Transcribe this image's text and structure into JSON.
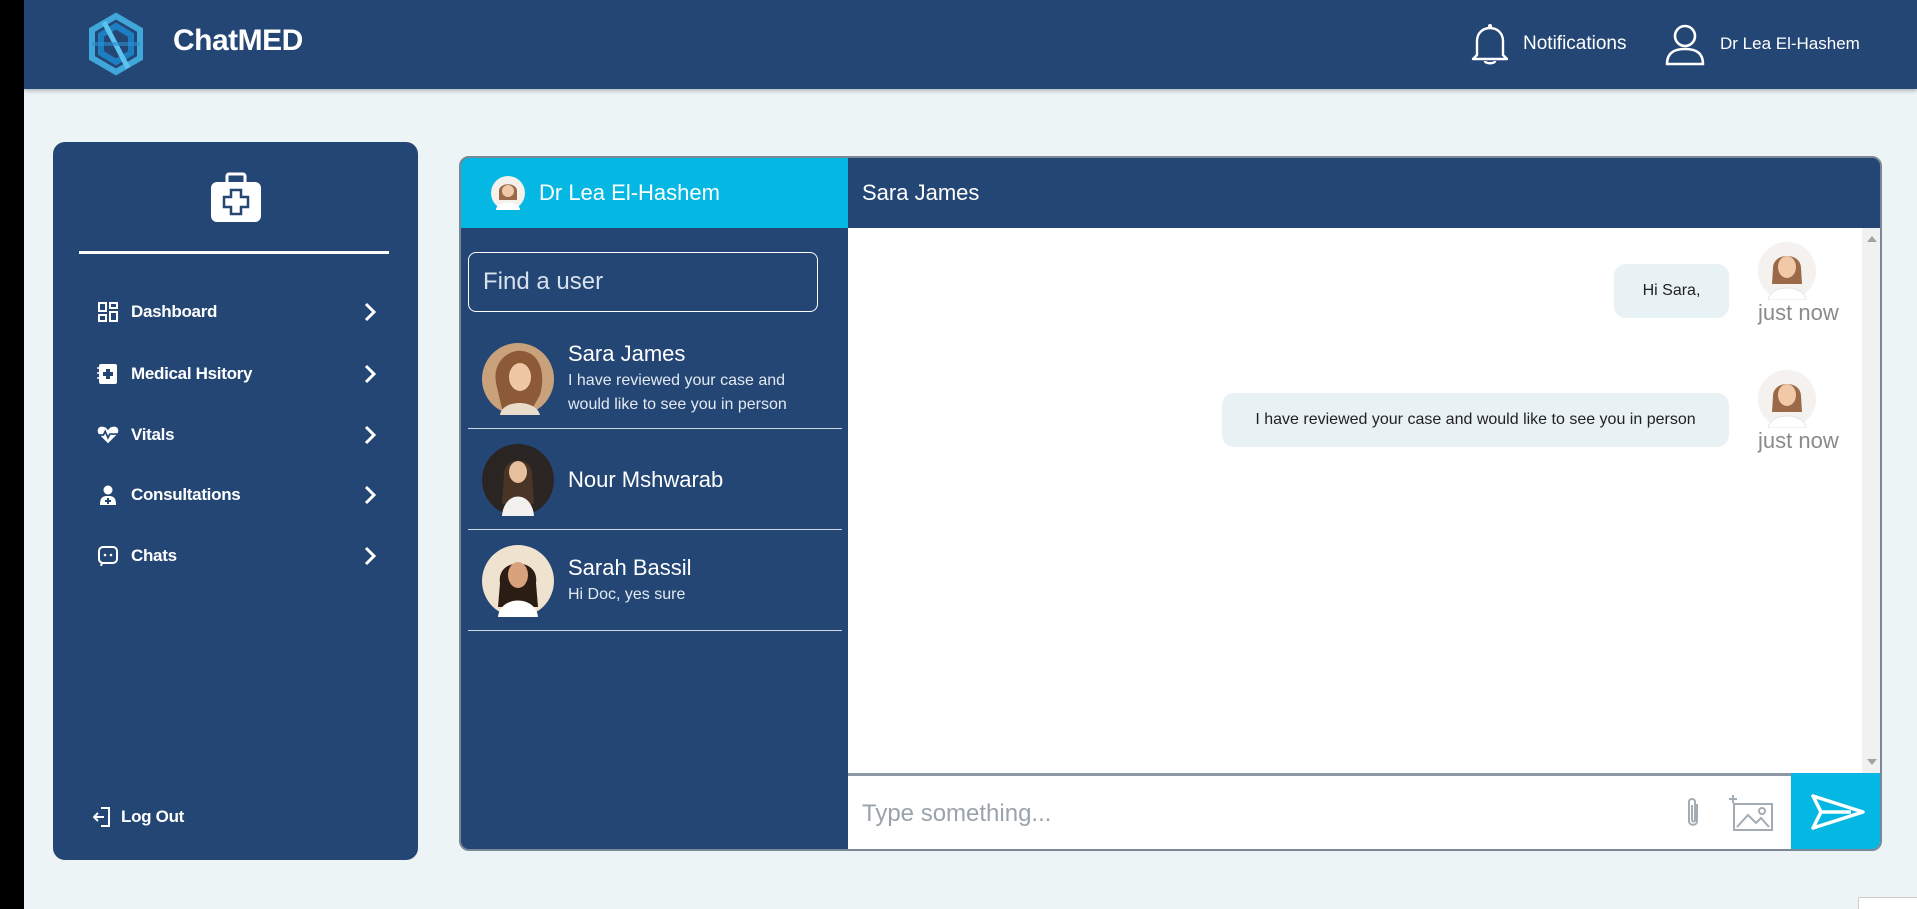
{
  "app": {
    "brand": "ChatMED"
  },
  "header": {
    "notifications_label": "Notifications",
    "user_name": "Dr Lea El-Hashem"
  },
  "sidebar": {
    "items": [
      {
        "label": "Dashboard",
        "icon": "dashboard-icon"
      },
      {
        "label": "Medical Hsitory",
        "icon": "medical-record-icon"
      },
      {
        "label": "Vitals",
        "icon": "heartbeat-icon"
      },
      {
        "label": "Consultations",
        "icon": "doctor-icon"
      },
      {
        "label": "Chats",
        "icon": "chat-icon"
      }
    ],
    "logout_label": "Log Out"
  },
  "chat": {
    "current_user": "Dr Lea El-Hashem",
    "active_contact": "Sara James",
    "search_placeholder": "Find a user",
    "contacts": [
      {
        "name": "Sara James",
        "last_message": "I have reviewed your case and would like to see you in person"
      },
      {
        "name": "Nour Mshwarab",
        "last_message": ""
      },
      {
        "name": "Sarah Bassil",
        "last_message": "Hi Doc, yes sure"
      }
    ],
    "messages": [
      {
        "text": "Hi Sara,",
        "time": "just now"
      },
      {
        "text": "I have reviewed your case and would like to see you in person",
        "time": "just now"
      }
    ],
    "composer_placeholder": "Type something..."
  },
  "colors": {
    "navy": "#244674",
    "accent": "#05b8e3",
    "page_bg": "#edf4f6",
    "bubble": "#e8f1f4"
  }
}
